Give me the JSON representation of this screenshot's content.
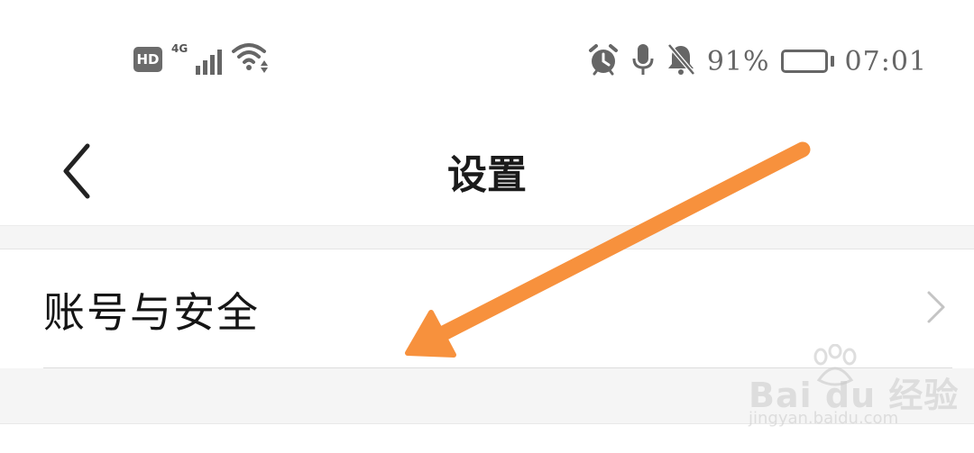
{
  "status_bar": {
    "hd_badge": "HD",
    "network_type": "4G",
    "battery_text": "91%",
    "battery_level": 0.91,
    "time": "07:01",
    "icons": [
      "hd-icon",
      "signal-icon",
      "wifi-icon",
      "alarm-icon",
      "microphone-icon",
      "bell-muted-icon",
      "battery-icon"
    ]
  },
  "header": {
    "title": "设置",
    "back_icon": "chevron-left-icon"
  },
  "settings": {
    "items": [
      {
        "label": "账号与安全",
        "icon": "chevron-right-icon"
      }
    ]
  },
  "annotation": {
    "arrow_color": "#F7913D",
    "arrow_icon": "arrow-annotation"
  },
  "watermark": {
    "brand": "Bai du 经验",
    "url": "jingyan.baidu.com"
  },
  "colors": {
    "background": "#FFFFFF",
    "section_gap": "#F5F5F5",
    "divider": "#DDDDDD",
    "status_icon": "#666666"
  }
}
